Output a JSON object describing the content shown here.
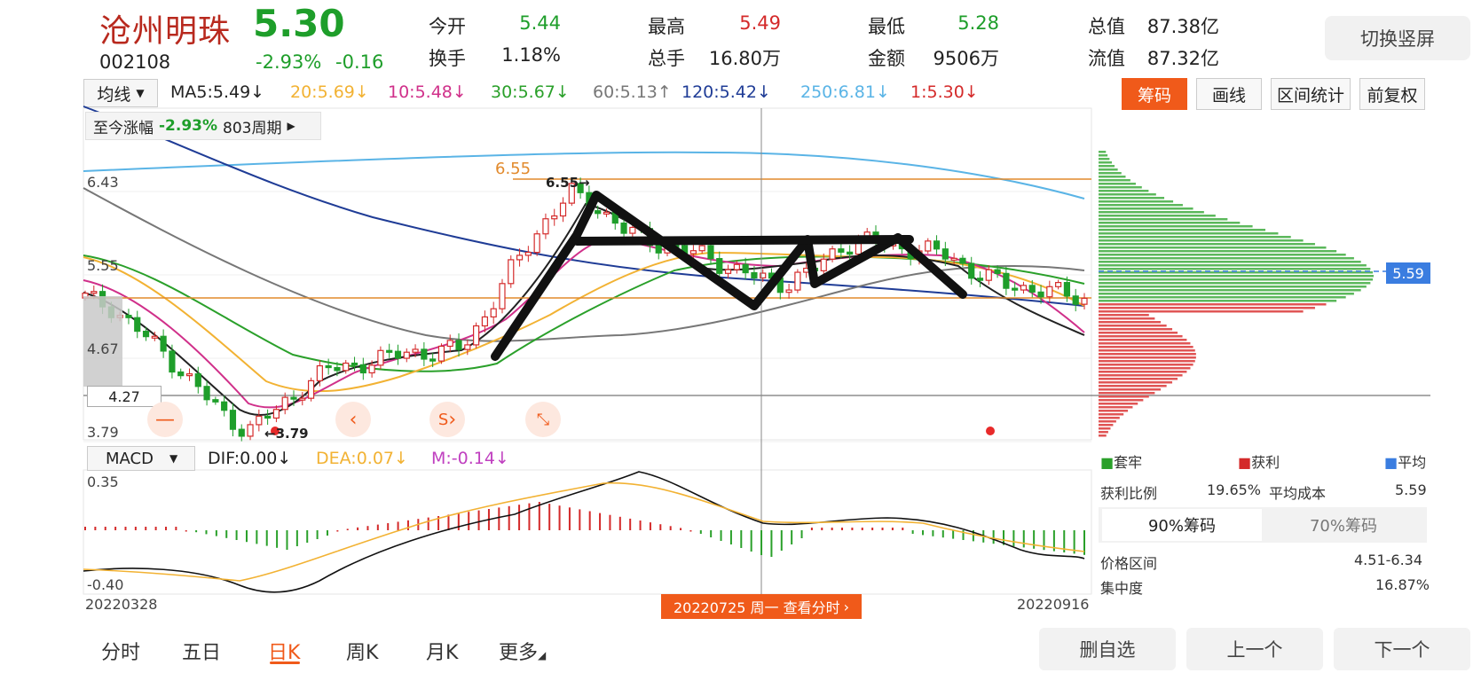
{
  "stock": {
    "name": "沧州明珠",
    "price": "5.30",
    "code": "002108",
    "change_pct": "-2.93%",
    "change_val": "-0.16"
  },
  "quote": {
    "open_label": "今开",
    "open": "5.44",
    "high_label": "最高",
    "high": "5.49",
    "low_label": "最低",
    "low": "5.28",
    "mcap_label": "总值",
    "mcap": "87.38亿",
    "turnover_label": "换手",
    "turnover": "1.18%",
    "vol_label": "总手",
    "vol": "16.80万",
    "amount_label": "金额",
    "amount": "9506万",
    "float_label": "流值",
    "float": "87.32亿"
  },
  "toolbar": {
    "rotate": "切换竖屏",
    "ma_select": "均线",
    "chips": "筹码",
    "draw": "画线",
    "range": "区间统计",
    "adjust": "前复权"
  },
  "ma": [
    {
      "label": "MA5:5.49",
      "arrow": "↓",
      "color": "#222222"
    },
    {
      "label": "20:5.69",
      "arrow": "↓",
      "color": "#f2b233"
    },
    {
      "label": "10:5.48",
      "arrow": "↓",
      "color": "#d0308a"
    },
    {
      "label": "30:5.67",
      "arrow": "↓",
      "color": "#2aa02a"
    },
    {
      "label": "60:5.13",
      "arrow": "↑",
      "color": "#777777"
    },
    {
      "label": "120:5.42",
      "arrow": "↓",
      "color": "#1f3c96"
    },
    {
      "label": "250:6.81",
      "arrow": "↓",
      "color": "#5ab4e6"
    },
    {
      "label": "1:5.30",
      "arrow": "↓",
      "color": "#d42a2a"
    }
  ],
  "since": {
    "label": "至今涨幅",
    "value": "-2.93%",
    "period": "803周期"
  },
  "price_axis": {
    "p1": "6.43",
    "p2": "5.55",
    "p3": "4.67",
    "p4": "3.79",
    "cursor": "4.27"
  },
  "annotations": {
    "high_mark": "6.55",
    "high_arrow": "6.55→",
    "low_mark": "←3.79",
    "sell_mark": "S"
  },
  "macd": {
    "select": "MACD",
    "dif": "DIF:0.00",
    "dif_arrow": "↓",
    "dea": "DEA:0.07",
    "dea_arrow": "↓",
    "m": "M:-0.14",
    "m_arrow": "↓",
    "top": "0.35",
    "bottom": "-0.40"
  },
  "dates": {
    "start": "20220328",
    "end": "20220916",
    "chip": "20220725 周一  查看分时"
  },
  "chips_panel": {
    "cursor_price": "5.59",
    "legend_trapped": "套牢",
    "legend_profit": "获利",
    "legend_avg": "平均",
    "profit_ratio_label": "获利比例",
    "profit_ratio": "19.65%",
    "avg_cost_label": "平均成本",
    "avg_cost": "5.59",
    "tab90": "90%筹码",
    "tab70": "70%筹码",
    "range_label": "价格区间",
    "range": "4.51-6.34",
    "conc_label": "集中度",
    "conc": "16.87%"
  },
  "bottom": {
    "tabs": [
      "分时",
      "五日",
      "日K",
      "周K",
      "月K",
      "更多"
    ],
    "delete": "删自选",
    "prev": "上一个",
    "next": "下一个"
  },
  "chart_data": {
    "type": "candlestick",
    "ylim": [
      3.79,
      6.55
    ],
    "x_start": "20220328",
    "x_end": "20220916",
    "high": 6.55,
    "low": 3.79,
    "close": 5.3,
    "trend_closes": [
      5.3,
      5.2,
      4.95,
      4.7,
      4.4,
      4.1,
      3.9,
      4.1,
      4.35,
      4.55,
      4.6,
      4.65,
      4.75,
      4.7,
      4.8,
      5.2,
      5.7,
      6.1,
      6.4,
      6.25,
      6.0,
      5.9,
      5.8,
      5.75,
      5.6,
      5.5,
      5.45,
      5.6,
      5.85,
      5.9,
      5.85,
      5.8,
      5.75,
      5.55,
      5.45,
      5.4,
      5.35,
      5.3
    ]
  }
}
